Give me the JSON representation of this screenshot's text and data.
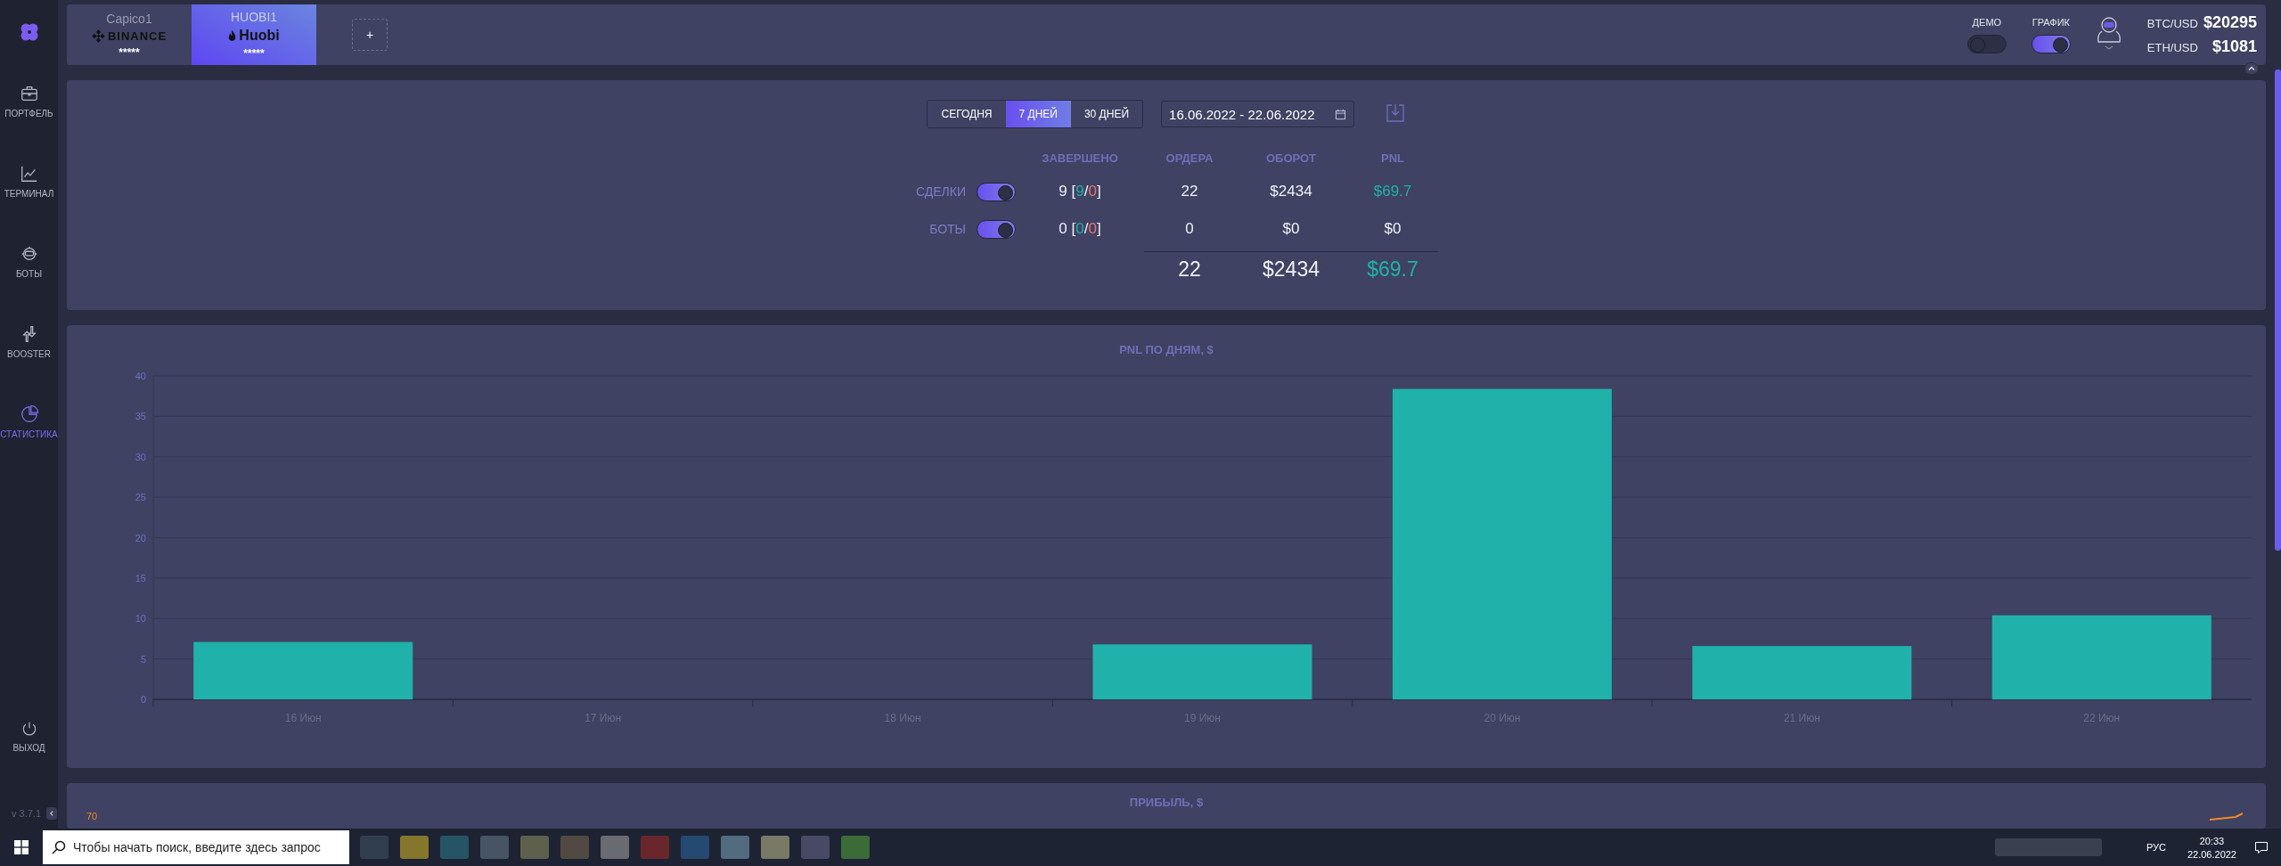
{
  "sidebar": {
    "items": [
      {
        "label": "ПОРТФЕЛЬ",
        "kind": "briefcase",
        "selected": false
      },
      {
        "label": "ТЕРМИНАЛ",
        "kind": "chart",
        "selected": false
      },
      {
        "label": "БОТЫ",
        "kind": "robot",
        "selected": false
      },
      {
        "label": "BOOSTER",
        "kind": "arrows",
        "selected": false
      },
      {
        "label": "СТАТИСТИКА",
        "kind": "pie",
        "selected": true
      }
    ],
    "logout": "ВЫХОД",
    "version": "v 3.7.1"
  },
  "accounts": [
    {
      "name": "Capico1",
      "exchange": "BINANCE",
      "kind": "binance",
      "mask": "*****",
      "selected": false
    },
    {
      "name": "HUOBI1",
      "exchange": "Huobi",
      "kind": "huobi",
      "mask": "*****",
      "selected": true
    }
  ],
  "add_account": "+",
  "header": {
    "toggles": [
      {
        "label": "ДЕМО",
        "on": false
      },
      {
        "label": "ГРАФИК",
        "on": true
      }
    ],
    "prices": [
      {
        "pair": "BTC/USD",
        "price": "$20295"
      },
      {
        "pair": "ETH/USD",
        "price": "$1081"
      }
    ]
  },
  "period_tabs": [
    {
      "label": "СЕГОДНЯ",
      "selected": false
    },
    {
      "label": "7 ДНЕЙ",
      "selected": true
    },
    {
      "label": "30 ДНЕЙ",
      "selected": false
    }
  ],
  "date_range": "16.06.2022 - 22.06.2022",
  "stats": {
    "columns": [
      "ЗАВЕРШЕНО",
      "ОРДЕРА",
      "ОБОРОТ",
      "PNL"
    ],
    "rows": [
      {
        "label": "СДЕЛКИ",
        "on": true,
        "completed": "9",
        "breakdown": [
          {
            "text": "[",
            "kind": "plain"
          },
          {
            "text": "9",
            "kind": "win"
          },
          {
            "text": "/",
            "kind": "plain"
          },
          {
            "text": "0",
            "kind": "loss"
          },
          {
            "text": "]",
            "kind": "plain"
          }
        ],
        "orders": "22",
        "turnover": "$2434",
        "pnl": "$69.7",
        "positive": true
      },
      {
        "label": "БОТЫ",
        "on": true,
        "completed": "0",
        "breakdown": [
          {
            "text": "[",
            "kind": "plain"
          },
          {
            "text": "0",
            "kind": "win"
          },
          {
            "text": "/",
            "kind": "plain"
          },
          {
            "text": "0",
            "kind": "loss"
          },
          {
            "text": "]",
            "kind": "plain"
          }
        ],
        "orders": "0",
        "turnover": "$0",
        "pnl": "$0",
        "positive": false
      }
    ],
    "totals": {
      "orders": "22",
      "turnover": "$2434",
      "pnl": "$69.7",
      "positive": true
    }
  },
  "pnl_chart": {
    "title": "PNL ПО ДНЯМ, $",
    "chart_data": {
      "type": "bar",
      "categories": [
        "16 Июн",
        "17 Июн",
        "18 Июн",
        "19 Июн",
        "20 Июн",
        "21 Июн",
        "22 Июн"
      ],
      "values": [
        7.1,
        0,
        0,
        6.8,
        38.4,
        6.6,
        10.4
      ],
      "grid": true,
      "ylim": [
        0,
        40
      ],
      "yticks": [
        0,
        5,
        10,
        15,
        20,
        25,
        30,
        35,
        40
      ]
    }
  },
  "profit_chart": {
    "title": "ПРИБЫЛЬ, $",
    "top_tick": "70"
  },
  "taskbar": {
    "search_placeholder": "Чтобы начать поиск, введите здесь запрос",
    "language": "РУС",
    "time": "20:33",
    "date": "22.06.2022"
  }
}
